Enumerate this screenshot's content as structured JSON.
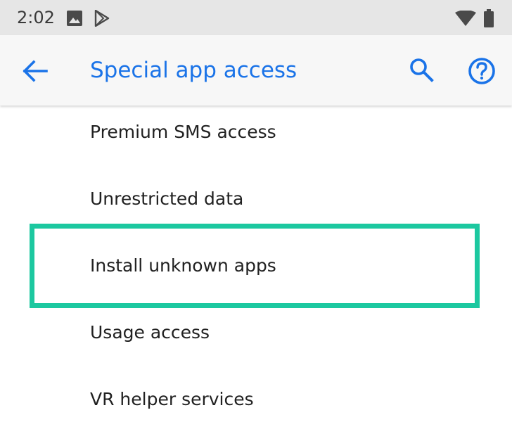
{
  "status_bar": {
    "time": "2:02",
    "icons": [
      "gallery-icon",
      "play-store-icon",
      "wifi-icon",
      "battery-icon"
    ]
  },
  "app_bar": {
    "title": "Special app access",
    "back_icon": "arrow-back-icon",
    "search_icon": "search-icon",
    "help_icon": "help-icon"
  },
  "list": {
    "items": [
      {
        "label": "Premium SMS access"
      },
      {
        "label": "Unrestricted data"
      },
      {
        "label": "Install unknown apps"
      },
      {
        "label": "Usage access"
      },
      {
        "label": "VR helper services"
      }
    ]
  },
  "colors": {
    "accent": "#1a73e8",
    "highlight": "#1cc8a0",
    "status_bar_bg": "#e6e6e6",
    "app_bar_bg": "#f7f7f7",
    "text": "#212121"
  }
}
